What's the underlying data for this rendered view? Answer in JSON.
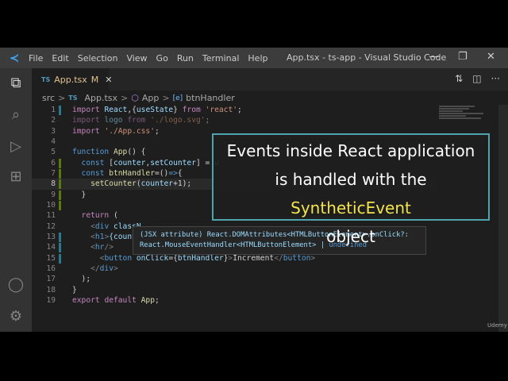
{
  "window": {
    "title": "App.tsx - ts-app - Visual Studio Code",
    "minimize": "—",
    "restore": "❐",
    "close": "✕"
  },
  "menu": [
    "File",
    "Edit",
    "Selection",
    "View",
    "Go",
    "Run",
    "Terminal",
    "Help"
  ],
  "activity_bar": [
    {
      "icon": "explorer-icon",
      "glyph": "⧉"
    },
    {
      "icon": "search-icon",
      "glyph": "⌕"
    },
    {
      "icon": "run-debug-icon",
      "glyph": "▷"
    },
    {
      "icon": "extensions-icon",
      "glyph": "⊞"
    },
    {
      "icon": "account-icon",
      "glyph": "◯"
    },
    {
      "icon": "settings-gear-icon",
      "glyph": "⚙"
    }
  ],
  "tab": {
    "lang": "TS",
    "name": "App.tsx",
    "status": "M",
    "close": "✕"
  },
  "tab_actions": {
    "compare": "⇅",
    "split": "◫",
    "more": "···"
  },
  "breadcrumb": {
    "folder": "src",
    "file_lang": "TS",
    "file": "App.tsx",
    "symbol1": "App",
    "symbol2": "btnHandler",
    "sep": ">"
  },
  "code": [
    {
      "n": "1",
      "t": [
        [
          "import ",
          "k"
        ],
        [
          "React",
          "v"
        ],
        [
          ",{",
          "p"
        ],
        [
          "useState",
          "v"
        ],
        [
          "} ",
          "p"
        ],
        [
          "from ",
          "k"
        ],
        [
          "'react'",
          "s"
        ],
        [
          ";",
          "p"
        ]
      ]
    },
    {
      "n": "2",
      "dim": true,
      "t": [
        [
          "import ",
          "k"
        ],
        [
          "logo ",
          "v"
        ],
        [
          "from ",
          "k"
        ],
        [
          "'./logo.svg'",
          "s"
        ],
        [
          ";",
          "p"
        ]
      ]
    },
    {
      "n": "3",
      "t": [
        [
          "import ",
          "k"
        ],
        [
          "'./App.css'",
          "s"
        ],
        [
          ";",
          "p"
        ]
      ]
    },
    {
      "n": "4",
      "t": []
    },
    {
      "n": "5",
      "t": [
        [
          "function ",
          "b"
        ],
        [
          "App",
          "f"
        ],
        [
          "() {",
          "p"
        ]
      ]
    },
    {
      "n": "6",
      "t": [
        [
          "  const ",
          "b"
        ],
        [
          "[",
          "p"
        ],
        [
          "counter",
          "v"
        ],
        [
          ",",
          "p"
        ],
        [
          "setCounter",
          "v"
        ],
        [
          "] = ",
          "p"
        ],
        [
          "u",
          "f"
        ]
      ]
    },
    {
      "n": "7",
      "t": [
        [
          "  const ",
          "b"
        ],
        [
          "btnHandler",
          "f"
        ],
        [
          "=()",
          "p"
        ],
        [
          "=>",
          "b"
        ],
        [
          "{",
          "p"
        ]
      ]
    },
    {
      "n": "8",
      "cur": true,
      "t": [
        [
          "    setCounter",
          "f"
        ],
        [
          "(",
          "p"
        ],
        [
          "counter",
          "v"
        ],
        [
          "+1);",
          "p"
        ]
      ]
    },
    {
      "n": "9",
      "t": [
        [
          "  }",
          "p"
        ]
      ]
    },
    {
      "n": "10",
      "t": []
    },
    {
      "n": "11",
      "t": [
        [
          "  return ",
          "k"
        ],
        [
          "(",
          "p"
        ]
      ]
    },
    {
      "n": "12",
      "t": [
        [
          "    <",
          "g"
        ],
        [
          "div ",
          "b"
        ],
        [
          "classN",
          "v"
        ]
      ]
    },
    {
      "n": "13",
      "t": [
        [
          "    <",
          "g"
        ],
        [
          "h1",
          "b"
        ],
        [
          ">",
          "g"
        ],
        [
          "{count",
          "v"
        ]
      ]
    },
    {
      "n": "14",
      "t": [
        [
          "    <",
          "g"
        ],
        [
          "hr",
          "b"
        ],
        [
          "/>",
          "g"
        ]
      ]
    },
    {
      "n": "15",
      "t": [
        [
          "      <",
          "g"
        ],
        [
          "button ",
          "b"
        ],
        [
          "onClick",
          "v"
        ],
        [
          "={",
          "p"
        ],
        [
          "btnHandler",
          "v"
        ],
        [
          "}",
          "p"
        ],
        [
          ">",
          "g"
        ],
        [
          "Increment",
          "p"
        ],
        [
          "</",
          "g"
        ],
        [
          "button",
          "b"
        ],
        [
          ">",
          "g"
        ]
      ]
    },
    {
      "n": "16",
      "t": [
        [
          "    </",
          "g"
        ],
        [
          "div",
          "b"
        ],
        [
          ">",
          "g"
        ]
      ]
    },
    {
      "n": "17",
      "t": [
        [
          "  );",
          "p"
        ]
      ]
    },
    {
      "n": "18",
      "t": [
        [
          "}",
          "p"
        ]
      ]
    },
    {
      "n": "19",
      "t": [
        [
          "export ",
          "k"
        ],
        [
          "default ",
          "k"
        ],
        [
          "App",
          "f"
        ],
        [
          ";",
          "p"
        ]
      ]
    }
  ],
  "tooltip": {
    "line1": "(JSX attribute) React.DOMAttributes<HTMLButtonElement>.onClick?:",
    "line2a": "React.MouseEventHandler<HTMLButtonElement> | ",
    "line2b": "undefined"
  },
  "overlay": {
    "line1": "Events inside React application",
    "line2a": "is handled with the ",
    "line2b": "SyntheticEvent",
    "line3": "object",
    "highlight_color": "#f3e34c",
    "border_color": "#4ea3ad"
  },
  "watermark": "Udemy"
}
